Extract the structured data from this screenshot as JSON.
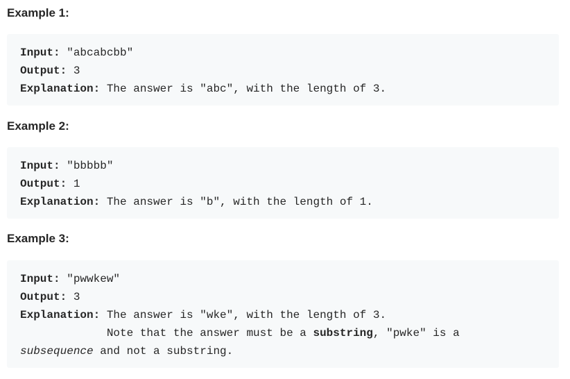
{
  "examples": [
    {
      "heading": "Example 1:",
      "input_label": "Input:",
      "input_value": " \"abcabcbb\"",
      "output_label": "Output:",
      "output_value": " 3",
      "explanation_label": "Explanation:",
      "explanation_value": " The answer is \"abc\", with the length of 3."
    },
    {
      "heading": "Example 2:",
      "input_label": "Input:",
      "input_value": " \"bbbbb\"",
      "output_label": "Output:",
      "output_value": " 1",
      "explanation_label": "Explanation:",
      "explanation_value": " The answer is \"b\", with the length of 1."
    },
    {
      "heading": "Example 3:",
      "input_label": "Input:",
      "input_value": " \"pwwkew\"",
      "output_label": "Output:",
      "output_value": " 3",
      "explanation_label": "Explanation:",
      "explanation_value": " The answer is \"wke\", with the length of 3.",
      "note_prefix": "             Note that the answer must be a ",
      "note_bold": "substring",
      "note_suffix": ", \"pwke\" is a",
      "note_italic": "subsequence",
      "note_end": " and not a substring."
    }
  ]
}
